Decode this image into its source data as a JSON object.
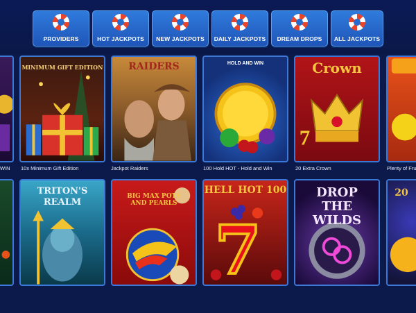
{
  "tabs": [
    {
      "label": "PROVIDERS",
      "icon": "lifebuoy-icon"
    },
    {
      "label": "HOT JACKPOTS",
      "icon": "lifebuoy-icon"
    },
    {
      "label": "NEW JACKPOTS",
      "icon": "lifebuoy-icon"
    },
    {
      "label": "DAILY JACKPOTS",
      "icon": "lifebuoy-icon"
    },
    {
      "label": "DREAM DROPS",
      "icon": "lifebuoy-icon"
    },
    {
      "label": "ALL JACKPOTS",
      "icon": "lifebuoy-icon"
    }
  ],
  "games_row1": [
    {
      "caption": "WIN",
      "logo": ""
    },
    {
      "caption": "10x Minimum Gift Edition",
      "logo": "MINIMUM GIFT EDITION"
    },
    {
      "caption": "Jackpot Raiders",
      "logo": "RAIDERS"
    },
    {
      "caption": "100 Hold HOT - Hold and Win",
      "logo": "HOLD AND WIN"
    },
    {
      "caption": "20 Extra Crown",
      "logo": "Crown"
    },
    {
      "caption": "Plenty of Fru",
      "logo": ""
    }
  ],
  "games_row2": [
    {
      "caption": "",
      "logo": ""
    },
    {
      "caption": "",
      "logo": "TRITON'S REALM"
    },
    {
      "caption": "",
      "logo": "BIG MAX POTS AND PEARLS"
    },
    {
      "caption": "",
      "logo": "HELL HOT 100"
    },
    {
      "caption": "",
      "logo": "DROP THE WILDS"
    },
    {
      "caption": "",
      "logo": "20"
    }
  ],
  "colors": {
    "background": "#0b1a4a",
    "tab": "#2f7bdc",
    "tile_border": "#3b78d8"
  }
}
